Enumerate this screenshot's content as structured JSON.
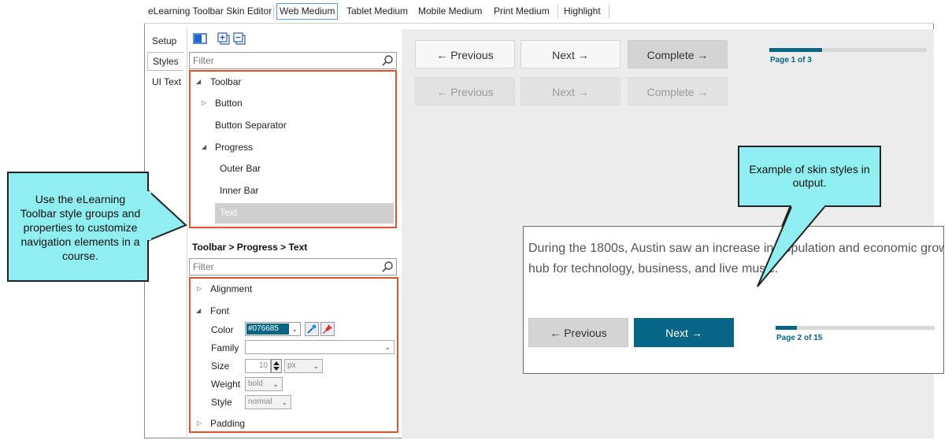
{
  "menubar": {
    "items": [
      {
        "label": "eLearning Toolbar Skin Editor"
      },
      {
        "label": "Web Medium"
      },
      {
        "label": "Tablet Medium"
      },
      {
        "label": "Mobile Medium"
      },
      {
        "label": "Print Medium"
      },
      {
        "label": "Highlight"
      }
    ]
  },
  "side_tabs": [
    {
      "label": "Setup"
    },
    {
      "label": "Styles"
    },
    {
      "label": "UI Text"
    }
  ],
  "style_tree": {
    "filter_placeholder": "Filter",
    "items": [
      {
        "label": "Toolbar",
        "expanded": true
      },
      {
        "label": "Button",
        "expanded": false
      },
      {
        "label": "Button Separator"
      },
      {
        "label": "Progress",
        "expanded": true
      },
      {
        "label": "Outer Bar"
      },
      {
        "label": "Inner Bar"
      },
      {
        "label": "Text",
        "selected": true
      }
    ]
  },
  "properties": {
    "breadcrumb": "Toolbar > Progress > Text",
    "filter_placeholder": "Filter",
    "groups": [
      {
        "label": "Alignment"
      },
      {
        "label": "Font"
      },
      {
        "label": "Padding"
      }
    ],
    "color_label": "Color",
    "color_value": "#076685",
    "family_label": "Family",
    "family_value": "",
    "size_label": "Size",
    "size_value": "10",
    "size_unit": "px",
    "weight_label": "Weight",
    "weight_value": "bold",
    "style_label": "Style",
    "style_value": "normal"
  },
  "preview": {
    "row1": {
      "previous": "← Previous",
      "next": "Next →",
      "complete": "Complete →"
    },
    "row2": {
      "previous": "← Previous",
      "next": "Next →",
      "complete": "Complete →"
    },
    "progress_text": "Page 1 of 3",
    "progress_fraction": 0.333
  },
  "callouts": {
    "left": "Use the eLearning Toolbar style groups and properties to customize navigation elements in a course.",
    "right": "Example of skin styles in output."
  },
  "output": {
    "line1": "During the 1800s, Austin saw an increase in population and economic grow",
    "line2": "hub for technology, business, and live music.",
    "previous": "← Previous",
    "next": "Next →",
    "progress_text": "Page 2 of 15",
    "progress_fraction": 0.133
  },
  "colors": {
    "accent": "#076685",
    "callout": "#8eeef0",
    "highlight_box": "#e0522b"
  }
}
